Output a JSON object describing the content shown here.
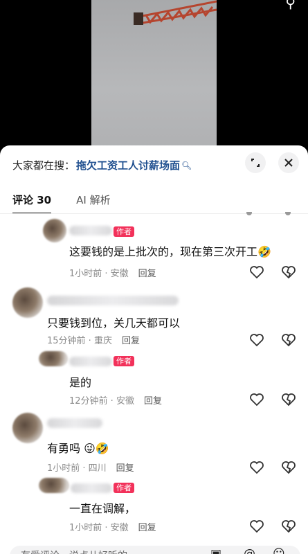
{
  "hot_search": {
    "prefix": "大家都在搜：",
    "query": "拖欠工资工人讨薪场面",
    "icon": "search-icon"
  },
  "tabs": [
    {
      "label": "评论 30",
      "active": true
    },
    {
      "label": "AI 解析",
      "active": false
    }
  ],
  "author_tag": "作者",
  "comments": [
    {
      "text": "这要钱的是上批次的，现在第三次开工",
      "emoji": "🤣",
      "time": "1小时前 · 安徽",
      "reply": "回复",
      "is_author": true
    },
    {
      "text": "只要钱到位，关几天都可以",
      "time": "15分钟前 · 重庆",
      "reply": "回复",
      "is_author": false
    },
    {
      "text": "是的",
      "time": "12分钟前 · 安徽",
      "reply": "回复",
      "is_author": true
    },
    {
      "text": "有勇吗",
      "emoji": "😜🤣",
      "time": "1小时前 · 四川",
      "reply": "回复",
      "is_author": false
    },
    {
      "text": "一直在调解，",
      "time": "1小时前 · 安徽",
      "reply": "回复",
      "is_author": true
    }
  ],
  "input": {
    "placeholder": "有爱评论，说点儿好听的"
  },
  "colors": {
    "author_tag": "#f2315a",
    "link": "#1f4f8f"
  }
}
